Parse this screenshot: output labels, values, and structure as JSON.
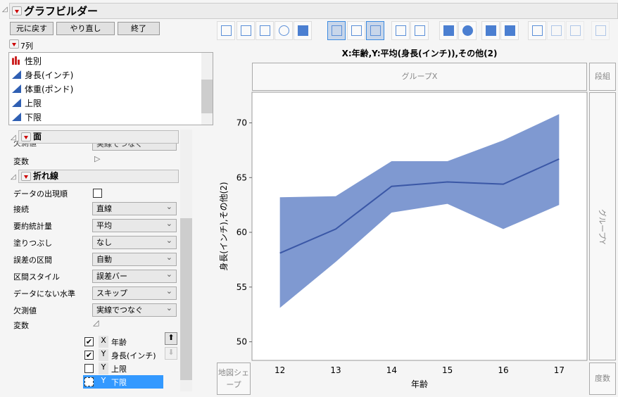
{
  "window": {
    "title": "グラフビルダー"
  },
  "buttons": {
    "undo": "元に戻す",
    "redo": "やり直し",
    "done": "終了"
  },
  "columns": {
    "header": "7列",
    "items": [
      {
        "name": "性別",
        "type": "nominal",
        "icon": "bar-chart-icon"
      },
      {
        "name": "身長(インチ)",
        "type": "continuous",
        "icon": "continuous-icon"
      },
      {
        "name": "体重(ポンド)",
        "type": "continuous",
        "icon": "continuous-icon"
      },
      {
        "name": "上限",
        "type": "continuous",
        "icon": "continuous-icon"
      },
      {
        "name": "下限",
        "type": "continuous",
        "icon": "continuous-icon"
      }
    ]
  },
  "area_section": {
    "title": "面",
    "missing_label": "欠測値",
    "missing_value": "実線でつなぐ",
    "variables_label": "変数"
  },
  "line_section": {
    "title": "折れ線",
    "order_label": "データの出現順",
    "order_checked": false,
    "rows": [
      {
        "label": "接続",
        "value": "直線"
      },
      {
        "label": "要約統計量",
        "value": "平均"
      },
      {
        "label": "塗りつぶし",
        "value": "なし"
      },
      {
        "label": "誤差の区間",
        "value": "自動"
      },
      {
        "label": "区間スタイル",
        "value": "誤差バー"
      },
      {
        "label": "データにない水準",
        "value": "スキップ"
      },
      {
        "label": "欠測値",
        "value": "実線でつなぐ"
      }
    ],
    "variables_label": "変数",
    "variables": [
      {
        "role": "X",
        "name": "年齢",
        "checked": true
      },
      {
        "role": "Y",
        "name": "身長(インチ)",
        "checked": true
      },
      {
        "role": "Y",
        "name": "上限",
        "checked": false
      },
      {
        "role": "Y",
        "name": "下限",
        "checked": false,
        "selected": true
      }
    ]
  },
  "toolbar": {
    "icons": [
      "points",
      "smoother",
      "line-of-fit",
      "ellipse",
      "contour",
      "line",
      "bar",
      "area",
      "box-plot",
      "histogram",
      "heatmap",
      "pie",
      "treemap",
      "mosaic",
      "caption-box",
      "formula",
      "map-shapes",
      "parallel-plot"
    ],
    "active": [
      "line",
      "area"
    ]
  },
  "graph": {
    "title": "X:年齢,Y:平均(身長(インチ)),その他(2)",
    "group_x": "グループX",
    "wrap": "段組",
    "group_y": "グループY",
    "map_shape": "地図シェープ",
    "freq": "度数",
    "accent": "#7f99d1",
    "line_color": "#3a57a6"
  },
  "chart_data": {
    "type": "area",
    "xlabel": "年齢",
    "ylabel": "身長(インチ),その他(2)",
    "x": [
      12,
      13,
      14,
      15,
      16,
      17
    ],
    "xlim": [
      11.5,
      17.5
    ],
    "ylim": [
      48.3,
      72.8
    ],
    "yticks": [
      50,
      55,
      60,
      65,
      70
    ],
    "series": [
      {
        "kind": "line",
        "values": [
          58.1,
          60.3,
          64.2,
          64.6,
          64.4,
          66.7
        ]
      },
      {
        "kind": "band-upper",
        "values": [
          63.2,
          63.3,
          66.5,
          66.5,
          68.4,
          70.8
        ]
      },
      {
        "kind": "band-lower",
        "values": [
          53.1,
          57.3,
          61.8,
          62.6,
          60.3,
          62.5
        ]
      }
    ]
  }
}
